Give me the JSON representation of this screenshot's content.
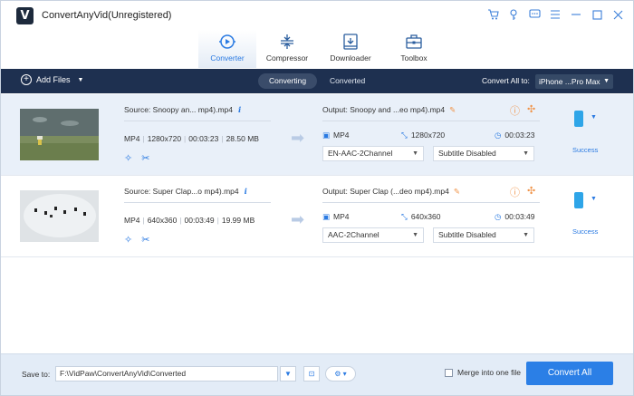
{
  "app": {
    "title": "ConvertAnyVid(Unregistered)",
    "logo_letter": "V"
  },
  "main_tabs": [
    {
      "label": "Converter",
      "icon": "converter-icon",
      "active": true
    },
    {
      "label": "Compressor",
      "icon": "compressor-icon",
      "active": false
    },
    {
      "label": "Downloader",
      "icon": "downloader-icon",
      "active": false
    },
    {
      "label": "Toolbox",
      "icon": "toolbox-icon",
      "active": false
    }
  ],
  "toolbar": {
    "add_files": "Add Files",
    "tabs": [
      "Converting",
      "Converted"
    ],
    "convert_all_label": "Convert All to:",
    "convert_all_value": "iPhone ...Pro Max"
  },
  "files": [
    {
      "source": "Source: Snoopy an... mp4).mp4",
      "format": "MP4",
      "resolution": "1280x720",
      "duration": "00:03:23",
      "size": "28.50 MB",
      "output": "Output: Snoopy and ...eo mp4).mp4",
      "out_format": "MP4",
      "out_resolution": "1280x720",
      "out_duration": "00:03:23",
      "audio": "EN-AAC-2Channel",
      "subtitle": "Subtitle Disabled",
      "status": "Success"
    },
    {
      "source": "Source: Super Clap...o mp4).mp4",
      "format": "MP4",
      "resolution": "640x360",
      "duration": "00:03:49",
      "size": "19.99 MB",
      "output": "Output: Super Clap (...deo mp4).mp4",
      "out_format": "MP4",
      "out_resolution": "640x360",
      "out_duration": "00:03:49",
      "audio": "AAC-2Channel",
      "subtitle": "Subtitle Disabled",
      "status": "Success"
    }
  ],
  "bottom": {
    "save_to_label": "Save to:",
    "save_path": "F:\\VidPaw\\ConvertAnyVid\\Converted",
    "merge_label": "Merge into one file",
    "convert_all_button": "Convert All"
  },
  "colors": {
    "accent": "#2b7fe6",
    "toolbar_bg": "#1e3050",
    "warning": "#f0944a"
  }
}
